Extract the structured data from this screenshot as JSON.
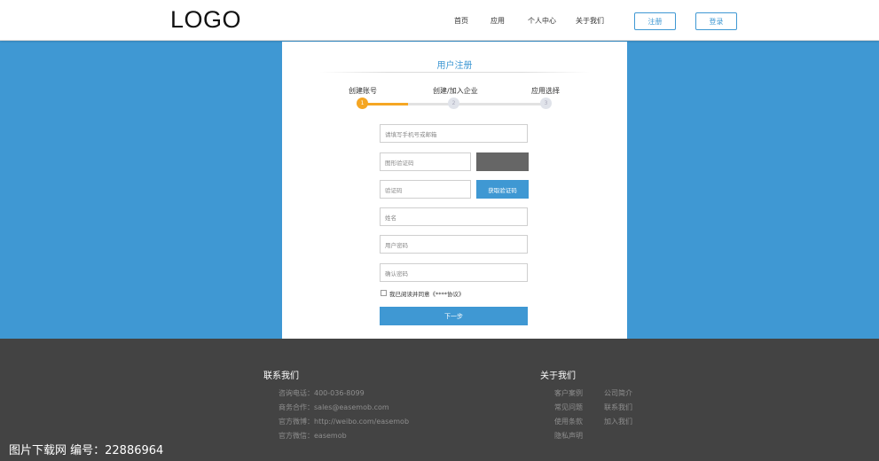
{
  "header": {
    "logo": "LOGO",
    "nav": [
      "首页",
      "应用",
      "个人中心",
      "关于我们"
    ],
    "register_label": "注册",
    "login_label": "登录"
  },
  "form": {
    "title": "用户注册",
    "steps": [
      {
        "label": "创建账号",
        "number": "1"
      },
      {
        "label": "创建/加入企业",
        "number": "2"
      },
      {
        "label": "应用选择",
        "number": "3"
      }
    ],
    "progress_fraction": 0.25,
    "fields": {
      "account_placeholder": "请填写手机号或邮箱",
      "captcha_placeholder": "图形验证码",
      "code_placeholder": "验证码",
      "name_placeholder": "姓名",
      "password_placeholder": "用户密码",
      "confirm_placeholder": "确认密码"
    },
    "get_code_label": "获取验证码",
    "agree_label": "我已阅读并同意《****协议》",
    "next_label": "下一步"
  },
  "footer": {
    "contact": {
      "heading": "联系我们",
      "lines": [
        "咨询电话：400-036-8099",
        "商务合作：sales@easemob.com",
        "官方微博：http://weibo.com/easemob",
        "官方微信：easemob"
      ]
    },
    "about": {
      "heading": "关于我们",
      "col1": [
        "客户案例",
        "常见问题",
        "使用条款",
        "隐私声明"
      ],
      "col2": [
        "公司简介",
        "联系我们",
        "加入我们"
      ]
    }
  },
  "watermark": "图片下载网  编号：22886964",
  "colors": {
    "accent": "#3f98d3",
    "step_active": "#f5a623",
    "footer_bg": "#434343",
    "captcha_bg": "#666666"
  }
}
